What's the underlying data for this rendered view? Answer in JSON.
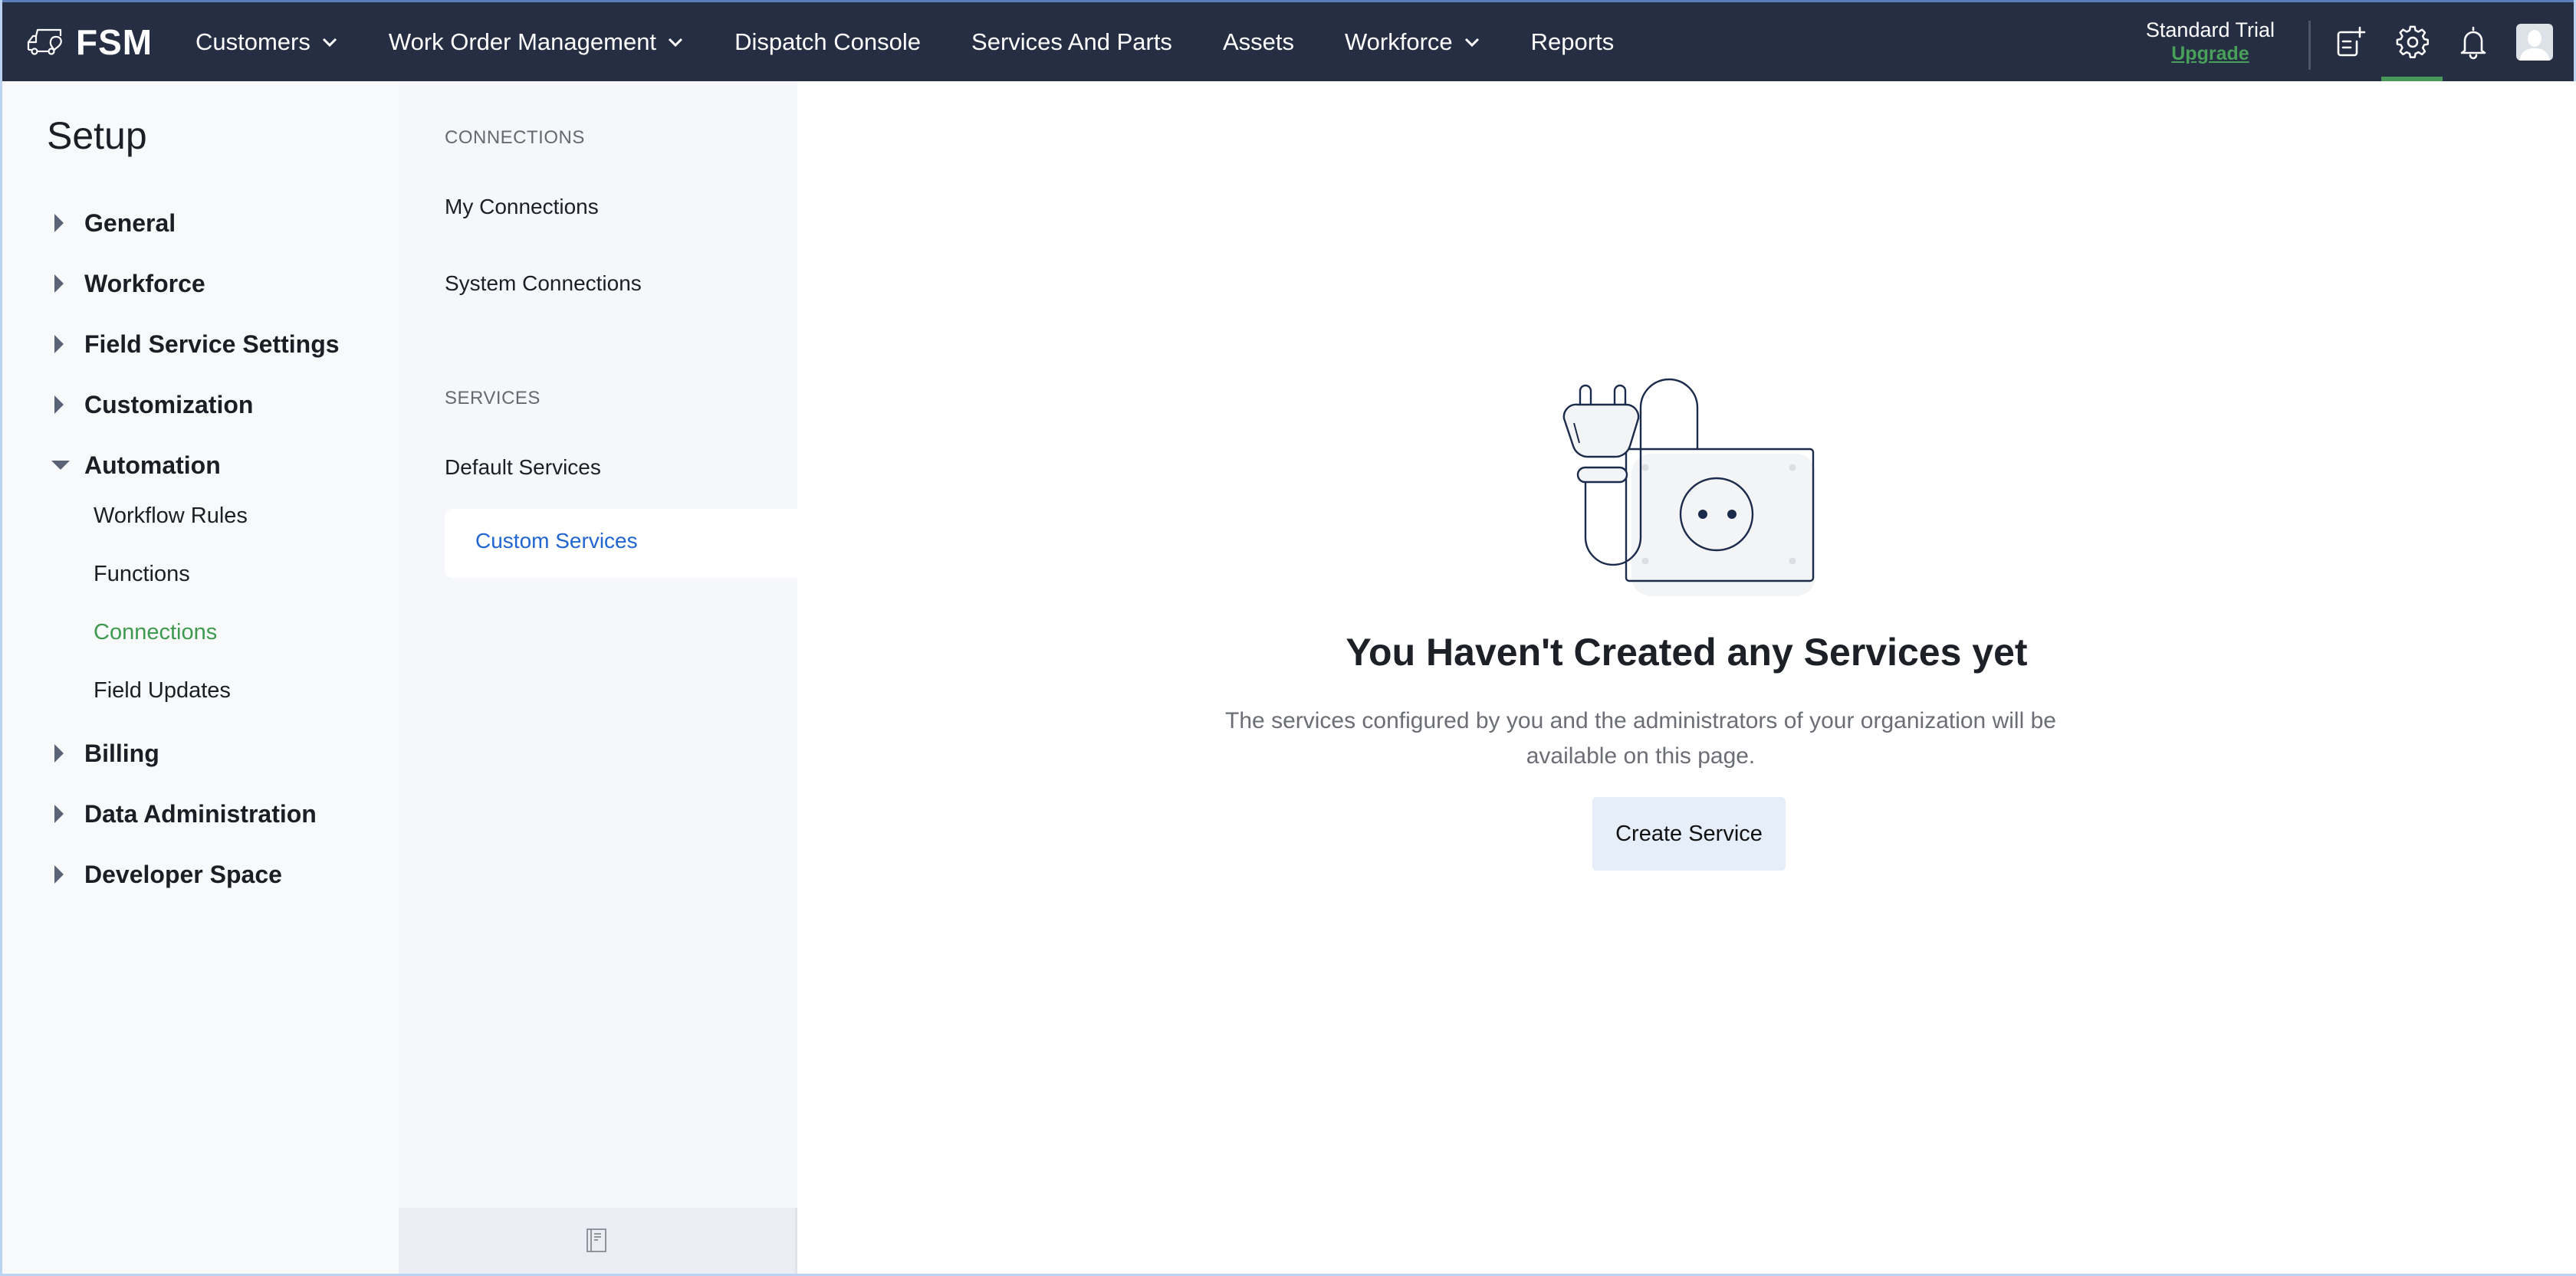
{
  "app": {
    "logo_text": "FSM",
    "logo_icon": "van-location-icon"
  },
  "nav": {
    "items": [
      {
        "label": "Customers",
        "has_dropdown": true
      },
      {
        "label": "Work Order Management",
        "has_dropdown": true
      },
      {
        "label": "Dispatch Console",
        "has_dropdown": false
      },
      {
        "label": "Services And Parts",
        "has_dropdown": false
      },
      {
        "label": "Assets",
        "has_dropdown": false
      },
      {
        "label": "Workforce",
        "has_dropdown": true
      },
      {
        "label": "Reports",
        "has_dropdown": false
      }
    ],
    "plan_name": "Standard Trial",
    "upgrade_label": "Upgrade",
    "icons": [
      "quick-create-icon",
      "settings-gear-icon",
      "notification-bell-icon",
      "user-avatar"
    ],
    "active_icon": "settings-gear-icon"
  },
  "sidebar": {
    "title": "Setup",
    "groups": [
      {
        "label": "General",
        "expanded": false
      },
      {
        "label": "Workforce",
        "expanded": false
      },
      {
        "label": "Field Service Settings",
        "expanded": false
      },
      {
        "label": "Customization",
        "expanded": false
      },
      {
        "label": "Automation",
        "expanded": true,
        "children": [
          {
            "label": "Workflow Rules",
            "active": false
          },
          {
            "label": "Functions",
            "active": false
          },
          {
            "label": "Connections",
            "active": true
          },
          {
            "label": "Field Updates",
            "active": false
          }
        ]
      },
      {
        "label": "Billing",
        "expanded": false
      },
      {
        "label": "Data Administration",
        "expanded": false
      },
      {
        "label": "Developer Space",
        "expanded": false
      }
    ]
  },
  "subpanel": {
    "sections": [
      {
        "heading": "CONNECTIONS",
        "items": [
          {
            "label": "My Connections"
          },
          {
            "label": "System Connections"
          }
        ]
      },
      {
        "heading": "SERVICES",
        "items": [
          {
            "label": "Default Services"
          },
          {
            "label": "Custom Services",
            "selected": true
          }
        ]
      }
    ],
    "footer_icon": "collapse-panel-icon"
  },
  "main": {
    "empty_state": {
      "illustration": "plug-and-socket-illustration",
      "title": "You Haven't Created any Services yet",
      "description": "The services configured by you and the administrators of your organization will be available on this page.",
      "button_label": "Create Service"
    }
  },
  "colors": {
    "topbar_bg": "#252e42",
    "accent_green": "#48985a",
    "link_blue": "#2165d1",
    "button_bg": "#e6eef9"
  }
}
